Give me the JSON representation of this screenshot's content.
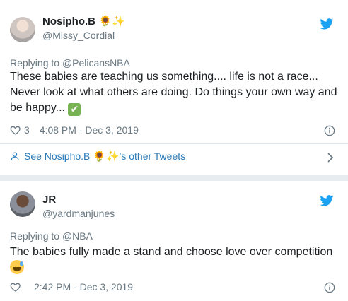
{
  "tweets": [
    {
      "display_name": "Nosipho.B",
      "name_emojis": [
        "sunflower-emoji",
        "sparkles-emoji"
      ],
      "handle": "@Missy_Cordial",
      "reply_prefix": "Replying to",
      "reply_to": "@PelicansNBA",
      "text": "These babies are teaching us something.... life is not a race... Never look at what others are doing. Do things your own way and be happy...",
      "text_emoji": "check-mark-emoji",
      "likes": "3",
      "timestamp": "4:08 PM - Dec 3, 2019"
    },
    {
      "display_name": "JR",
      "handle": "@yardmanjunes",
      "reply_prefix": "Replying to",
      "reply_to": "@NBA",
      "text": "The babies fully made a stand and choose love over competition",
      "text_emoji": "grinning-sweat-emoji",
      "likes": "",
      "timestamp": "2:42 PM - Dec 3, 2019"
    }
  ],
  "other_tweets": {
    "prefix": "See Nosipho.B",
    "suffix": "'s other Tweets"
  },
  "colors": {
    "background": "#e6ecf0",
    "card": "#ffffff",
    "twitter_blue": "#1da1f2",
    "link": "#2b7bb9",
    "muted": "#697882",
    "text": "#1c2022"
  },
  "icons": [
    "twitter-bird-icon",
    "heart-icon",
    "info-icon",
    "person-icon",
    "chevron-right-icon"
  ]
}
